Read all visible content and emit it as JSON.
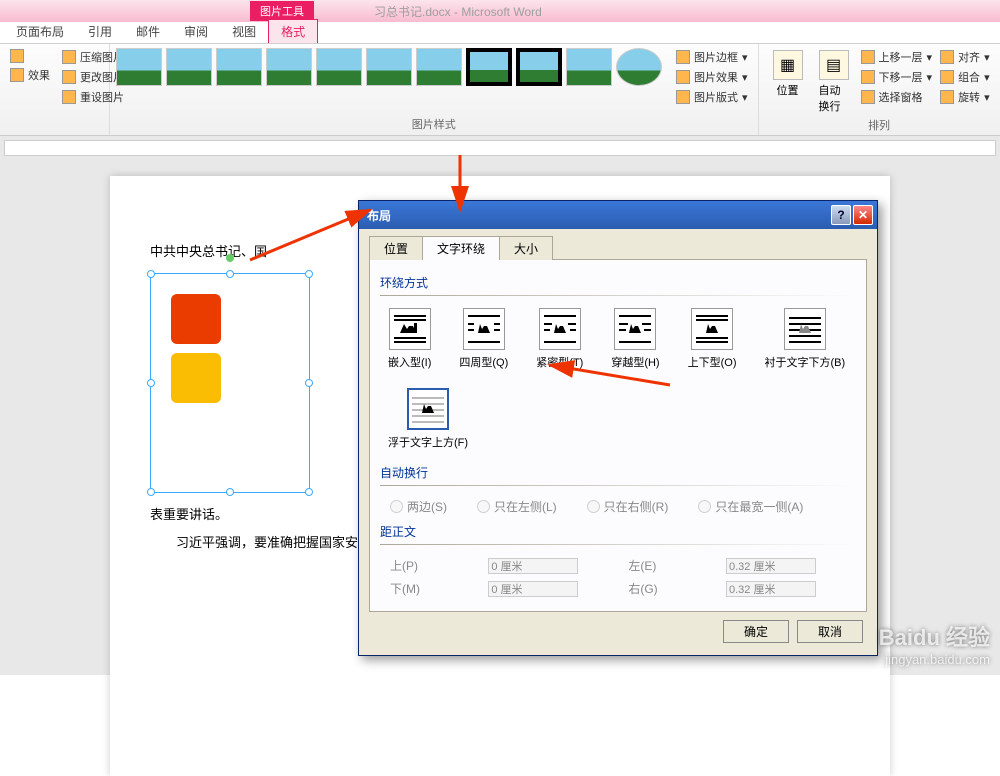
{
  "titlebar": {
    "contextual": "图片工具",
    "document": "习总书记.docx - Microsoft Word"
  },
  "tabs": {
    "layout": "页面布局",
    "references": "引用",
    "mailings": "邮件",
    "review": "审阅",
    "view": "视图",
    "format": "格式"
  },
  "ribbon": {
    "adjust": {
      "effects": "效果",
      "compress": "压缩图片",
      "change": "更改图片",
      "reset": "重设图片"
    },
    "styles": {
      "label": "图片样式",
      "border": "图片边框",
      "fx": "图片效果",
      "layout": "图片版式"
    },
    "arrange": {
      "label": "排列",
      "position": "位置",
      "wrap": "自动换行",
      "forward": "上移一层",
      "backward": "下移一层",
      "pane": "选择窗格",
      "align": "对齐",
      "group": "组合",
      "rotate": "旋转"
    }
  },
  "document": {
    "p1": "中共中央总书记、国",
    "p2": "表重要讲话。",
    "p3": "习近平强调，要准确把握国家安全形势变化新特点新趋势，坚持总体国家安全观，走出一条中国特色国家安全道路。"
  },
  "dialog": {
    "title": "布局",
    "tabs": {
      "position": "位置",
      "wrap": "文字环绕",
      "size": "大小"
    },
    "wrap_section": "环绕方式",
    "options": {
      "inline": "嵌入型(I)",
      "square": "四周型(Q)",
      "tight": "紧密型(T)",
      "through": "穿越型(H)",
      "topbottom": "上下型(O)",
      "behind": "衬于文字下方(B)",
      "front": "浮于文字上方(F)"
    },
    "autowrap_section": "自动换行",
    "radios": {
      "both": "两边(S)",
      "left": "只在左侧(L)",
      "right": "只在右侧(R)",
      "largest": "只在最宽一侧(A)"
    },
    "distance_section": "距正文",
    "dist": {
      "top_l": "上(P)",
      "top_v": "0 厘米",
      "bottom_l": "下(M)",
      "bottom_v": "0 厘米",
      "left_l": "左(E)",
      "left_v": "0.32 厘米",
      "right_l": "右(G)",
      "right_v": "0.32 厘米"
    },
    "ok": "确定",
    "cancel": "取消"
  },
  "watermark": {
    "brand": "Baidu 经验",
    "url": "jingyan.baidu.com"
  }
}
